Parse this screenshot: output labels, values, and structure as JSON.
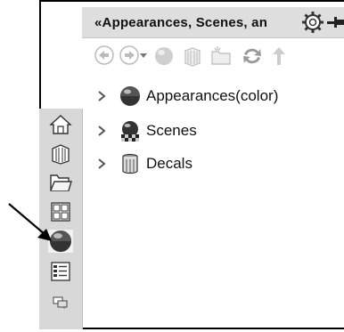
{
  "title_bar": {
    "title": "Appearances, Scenes, an"
  },
  "toolbar": {
    "items": [
      "back-icon",
      "forward-dropdown-icon",
      "appearance-sphere-icon",
      "book-icon",
      "new-folder-icon",
      "refresh-icon",
      "up-arrow-icon"
    ]
  },
  "tree": {
    "items": [
      {
        "label": "Appearances(color)",
        "icon": "appearance-sphere-icon"
      },
      {
        "label": "Scenes",
        "icon": "scene-icon"
      },
      {
        "label": "Decals",
        "icon": "decal-icon"
      }
    ]
  },
  "sidebar": {
    "tabs": [
      "home-icon",
      "design-library-icon",
      "file-explorer-icon",
      "view-palette-icon",
      "appearances-scenes-decals-icon",
      "custom-properties-icon",
      "forum-icon"
    ],
    "active_tab": "appearances-scenes-decals-icon"
  },
  "colors": {
    "panel_bg": "#ffffff",
    "title_bg": "#dedede",
    "sidebar_bg": "#d8d8d8"
  }
}
